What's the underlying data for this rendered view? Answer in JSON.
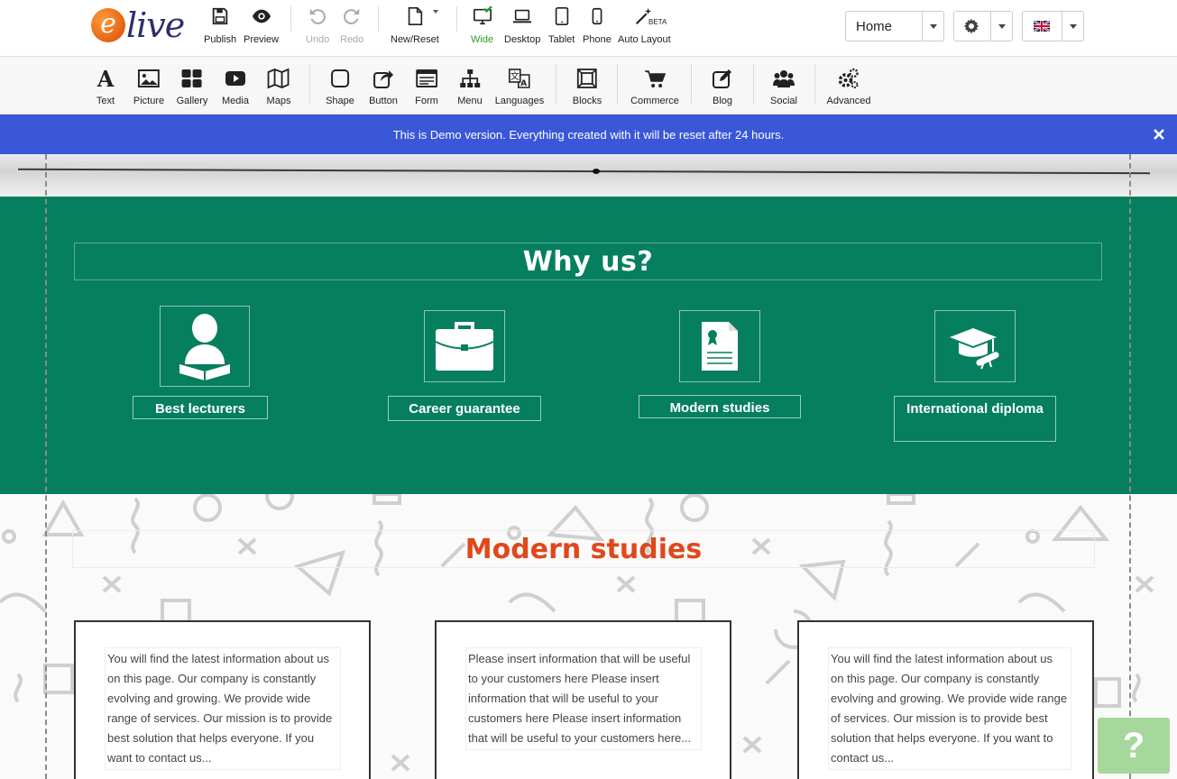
{
  "logo": {
    "letter": "e",
    "text": "live"
  },
  "toolbar": {
    "publish": "Publish",
    "preview": "Preview",
    "undo": "Undo",
    "redo": "Redo",
    "new_reset": "New/Reset",
    "wide": "Wide",
    "desktop": "Desktop",
    "tablet": "Tablet",
    "phone": "Phone",
    "auto_layout": "Auto Layout",
    "beta": "BETA"
  },
  "page_select": {
    "value": "Home"
  },
  "colors": {
    "accent_blue": "#3a57d9",
    "section_green": "#067f5f",
    "heading_orange": "#e0481b",
    "active_green": "#2a9d2a"
  },
  "tools": [
    {
      "label": "Text",
      "icon": "text-icon"
    },
    {
      "label": "Picture",
      "icon": "picture-icon"
    },
    {
      "label": "Gallery",
      "icon": "gallery-icon"
    },
    {
      "label": "Media",
      "icon": "media-icon"
    },
    {
      "label": "Maps",
      "icon": "map-icon"
    },
    {
      "label": "Shape",
      "icon": "shape-icon"
    },
    {
      "label": "Button",
      "icon": "button-icon"
    },
    {
      "label": "Form",
      "icon": "form-icon"
    },
    {
      "label": "Menu",
      "icon": "menu-icon"
    },
    {
      "label": "Languages",
      "icon": "languages-icon"
    },
    {
      "label": "Blocks",
      "icon": "blocks-icon"
    },
    {
      "label": "Commerce",
      "icon": "cart-icon"
    },
    {
      "label": "Blog",
      "icon": "blog-icon"
    },
    {
      "label": "Social",
      "icon": "social-icon"
    },
    {
      "label": "Advanced",
      "icon": "advanced-icon"
    }
  ],
  "banner": {
    "text": "This is Demo version. Everything created with it will be reset after 24 hours."
  },
  "why": {
    "title": "Why us?",
    "features": [
      {
        "label": "Best lecturers",
        "icon": "lecturer-icon"
      },
      {
        "label": "Career guarantee",
        "icon": "briefcase-icon"
      },
      {
        "label": "Modern studies",
        "icon": "certificate-icon"
      },
      {
        "label": "International diploma",
        "icon": "graduation-cap-icon"
      }
    ]
  },
  "studies": {
    "title": "Modern studies",
    "cards": [
      {
        "text": "You will find the latest information about us on this page. Our company is constantly evolving and growing. We provide wide range of services. Our mission is to provide best solution that helps everyone. If you want to contact us..."
      },
      {
        "text": "Please insert information that will be useful to your customers here Please insert information that will be useful to your customers here Please insert information that will be useful to your customers here..."
      },
      {
        "text": "You will find the latest information about us on this page. Our company is constantly evolving and growing. We provide wide range of services. Our mission is to provide best solution that helps everyone. If you want to contact us..."
      }
    ]
  },
  "help": {
    "label": "?"
  }
}
